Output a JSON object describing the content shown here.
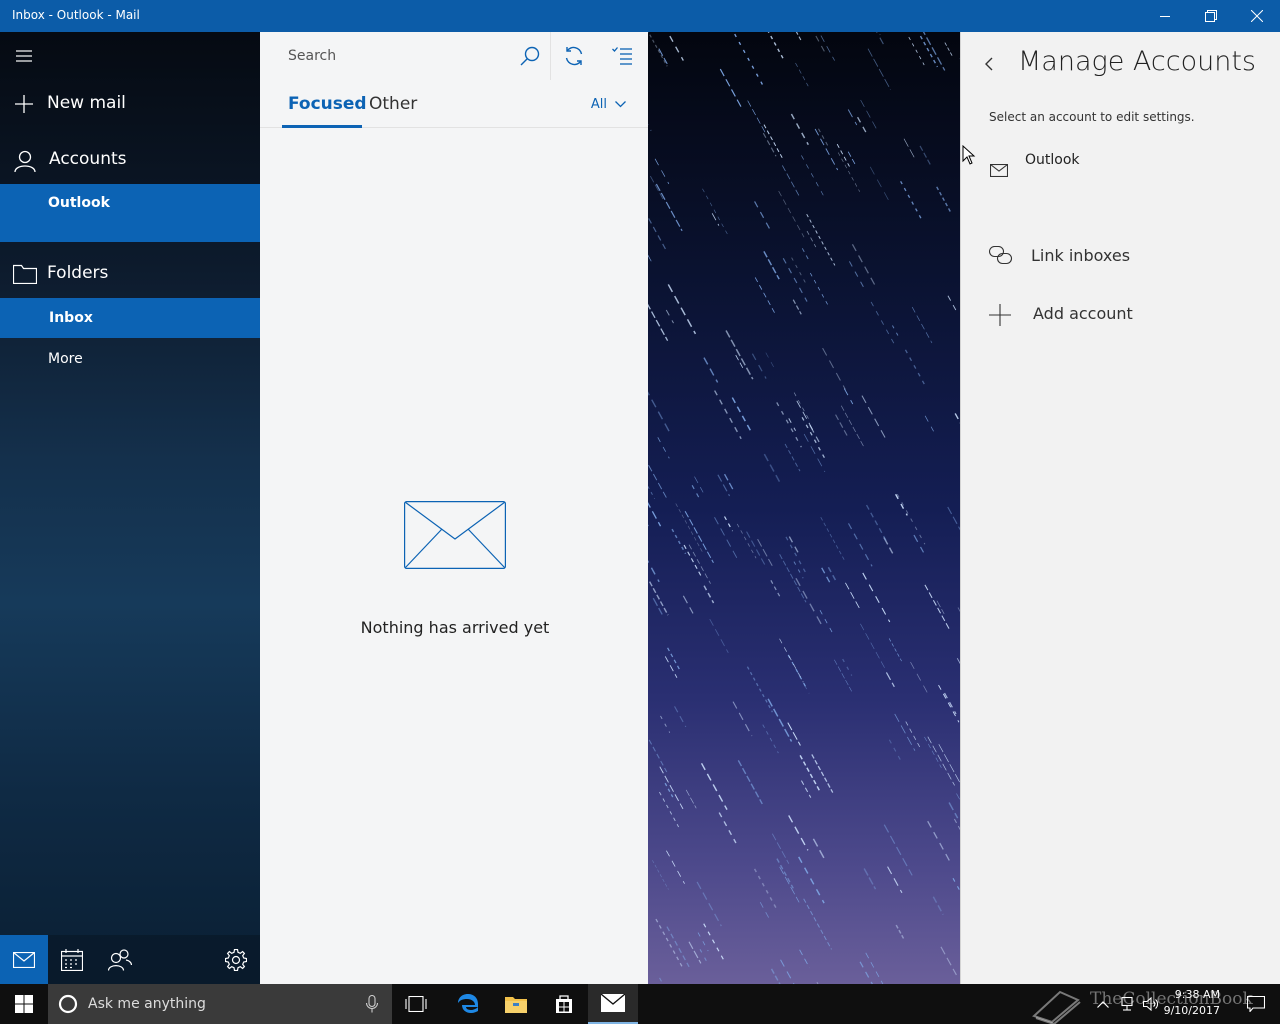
{
  "window": {
    "title": "Inbox - Outlook - Mail"
  },
  "nav": {
    "new_mail": "New mail",
    "accounts": "Accounts",
    "account_selected": "Outlook",
    "folders": "Folders",
    "inbox": "Inbox",
    "more": "More"
  },
  "list": {
    "search_placeholder": "Search",
    "tab_focused": "Focused",
    "tab_other": "Other",
    "filter": "All",
    "empty_message": "Nothing has arrived yet"
  },
  "manage": {
    "title": "Manage Accounts",
    "subtitle": "Select an account to edit settings.",
    "account_name": "Outlook",
    "link_inboxes": "Link inboxes",
    "add_account": "Add account"
  },
  "taskbar": {
    "search_placeholder": "Ask me anything",
    "time": "9:38 AM",
    "date": "9/10/2017",
    "watermark": "TheCollectionBook"
  },
  "colors": {
    "accent": "#0c63b4",
    "titlebar": "#0c5ca8"
  }
}
